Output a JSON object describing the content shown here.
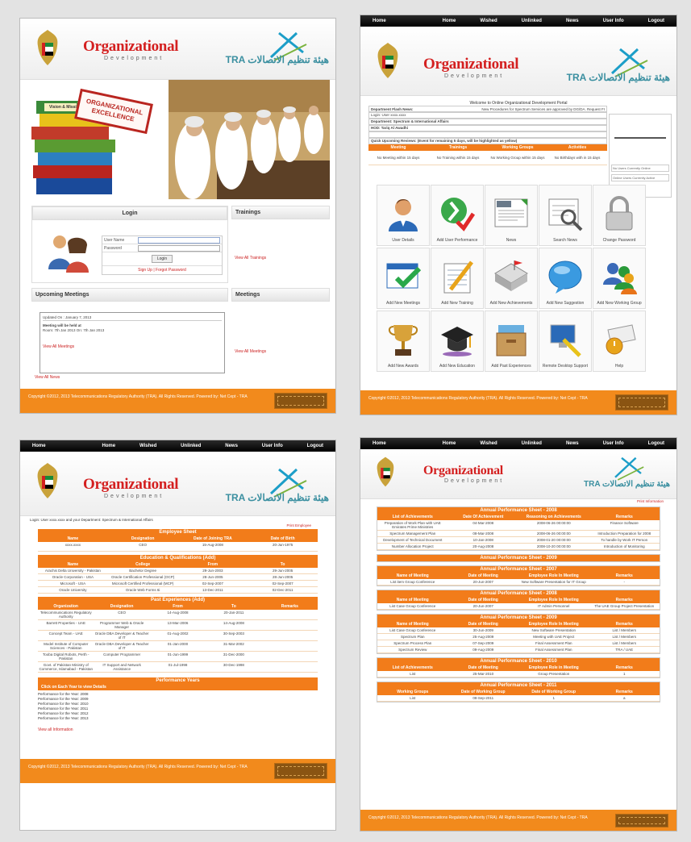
{
  "brand": {
    "title": "Organizational",
    "subtitle": "Development",
    "tdra": "TRA هيئة تنظيم الاتصالات"
  },
  "footer": {
    "text": "Copyright ©2012, 2013 Telecommunications Regulatory Authority (TRA). All Rights Reserved. Powered by: Net Cept - TRA"
  },
  "nav": [
    "Home",
    "Home",
    "Wished",
    "Unlinked",
    "News",
    "User Info",
    "Logout"
  ],
  "p1": {
    "banner": "ORGANIZATIONAL EXCELLENCE",
    "book_label": "Vision & Mission",
    "login": {
      "title": "Login",
      "user_label": "User Name",
      "pass_label": "Password",
      "button": "Login",
      "links": "Sign Up | Forgot Password"
    },
    "trainings": {
      "title": "Trainings",
      "link": "View All Trainings"
    },
    "upcoming": {
      "title": "Upcoming Meetings",
      "date": "Updated On : January 7, 2013",
      "heading": "Meeting will be held at",
      "line": "Room: 7th Jan 2013 On: 7th Jan 2013",
      "more": "View All Meetings",
      "news_link": "View All News"
    },
    "meetings": {
      "title": "Meetings",
      "link": "View All Meetings"
    }
  },
  "p2": {
    "welcome": "Welcome to Online Organizational Development Portal",
    "flash_label": "Department Flash News:",
    "flash_text": "New Procedures for Spectrum Services are approved by DG/DA. Request FI",
    "login_user": "Login: User  xxxx.xxxx",
    "department": "Department: Spectrum & International Affairs",
    "hod": "HOD: Tariq Al Awadhi",
    "reviews": "Quick Upcoming Reviews: (Event for remaining 5 days, will be highlighted as yellow)",
    "cols": [
      "Meeting",
      "Trainings",
      "Working Groups",
      "Activities"
    ],
    "vals": [
      "No Meeting within 15 days",
      "No Training within 15 days",
      "No Working Group within 15 days",
      "No Birthdays with in 15 days"
    ],
    "side": [
      "No Users Currently Online",
      "Online Users Currently Active"
    ],
    "icons": [
      {
        "name": "user-details",
        "label": "User Details"
      },
      {
        "name": "add-user-performance",
        "label": "Add User Performance"
      },
      {
        "name": "news",
        "label": "News"
      },
      {
        "name": "search-news",
        "label": "Search News"
      },
      {
        "name": "change-password",
        "label": "Change Password"
      },
      {
        "name": "add-new-meetings",
        "label": "Add New Meetings"
      },
      {
        "name": "add-new-training",
        "label": "Add New Training"
      },
      {
        "name": "add-new-achievements",
        "label": "Add New Achievements"
      },
      {
        "name": "add-new-suggestion",
        "label": "Add New Suggestion"
      },
      {
        "name": "add-new-working-group",
        "label": "Add New Working Group"
      },
      {
        "name": "add-new-awards",
        "label": "Add New Awards"
      },
      {
        "name": "add-new-education",
        "label": "Add New Education"
      },
      {
        "name": "add-past-experiences",
        "label": "Add Past Experiences"
      },
      {
        "name": "remote-desktop-support",
        "label": "Remote Desktop Support"
      },
      {
        "name": "help",
        "label": "Help"
      }
    ]
  },
  "p3": {
    "login_line": "Login: User  xxxx.xxxx  and your Department:  Spectrum & International Affairs",
    "print": "Print Employee",
    "employee_sheet": "Employee Sheet",
    "emp_cols": [
      "Name",
      "Designation",
      "Date of Joining TRA",
      "Date of Birth"
    ],
    "emp_vals": [
      "xxxx.xxxx",
      "CEO",
      "15-Aug-2008",
      "20-Jun-1975"
    ],
    "edu_title": "Education & Qualifications (Add)",
    "edu_cols": [
      "Name",
      "College",
      "From",
      "To"
    ],
    "edu_rows": [
      [
        "Arachis Delta University - Pakistan",
        "Bachelor Degree",
        "29-Jun-2003",
        "29-Jun-2005"
      ],
      [
        "Oracle Corporation - USA",
        "Oracle Certification Professional (OCP)",
        "28-Jun-2005",
        "28-Jun-2005"
      ],
      [
        "Microsoft - USA",
        "Microsoft Certified Professional (MCP)",
        "02-Sep-2007",
        "02-Sep-2007"
      ],
      [
        "Oracle University",
        "Oracle Web Forms 6i",
        "13-Dec-2011",
        "02-Dec-2011"
      ]
    ],
    "exp_title": "Past Experiences (Add)",
    "exp_cols": [
      "Organization",
      "Designation",
      "From",
      "To",
      "Remarks"
    ],
    "exp_rows": [
      [
        "Telecommunications Regulatory Authority",
        "CEO",
        "14-Aug-2008",
        "20-Jan-2011",
        ""
      ],
      [
        "Barrett Properties - UAE",
        "Programmer Web & Oracle Manager",
        "13-Mar-2006",
        "14-Aug-2008",
        ""
      ],
      [
        "Concept Team - UAE",
        "Oracle DBA Developer & Teacher of IT",
        "01-Aug-2002",
        "30-Sep-2003",
        ""
      ],
      [
        "Model Institute of Computer Sciences - Pakistan",
        "Oracle DBA Developer & Teacher of IT",
        "01-Jan-2000",
        "31-Mar-2002",
        ""
      ],
      [
        "Tooba Digital Robots, Perth - Pakistan",
        "Computer Programmer",
        "01-Jun-1999",
        "31-Dec-2000",
        ""
      ],
      [
        "Govt. of Pakistan Ministry of Commerce, Islamabad - Pakistan",
        "IT Support and Network Assistance",
        "01-Jul-1998",
        "30-Dec-1998",
        ""
      ]
    ],
    "perf_title": "Performance Years",
    "perf_sub": "Click on Each Year to view Details",
    "perf_years": [
      "Performance for the Year: 2008",
      "Performance for the Year: 2009",
      "Performance for the Year: 2010",
      "Performance for the Year: 2011",
      "Performance for the Year: 2012",
      "Performance for the Year: 2013"
    ],
    "view_all": "View all Information"
  },
  "p4": {
    "print": "Print Information",
    "sheets": [
      {
        "title": "Annual Performance Sheet - 2008",
        "cols": [
          "List of Achievements",
          "Date Of Achievement",
          "Reasoning on Achievements",
          "Remarks"
        ],
        "rows": [
          [
            "Preparation of Work Plan with UAE Emirates Prime Ministries",
            "04-Mar-2008",
            "2008-06-26 00:00:00",
            "Finance Software"
          ],
          [
            "Spectrum Management Plan",
            "08-Mar-2008",
            "2008-06-26 00:00:00",
            "Introduction Preparation for 2008"
          ],
          [
            "Development of Technical Document",
            "10-Jan-2008",
            "2008-01-20 00:00:00",
            "To handle by Work IT Person"
          ],
          [
            "Number Allocation Project",
            "20-Aug-2008",
            "2008-10-20 00:00:00",
            "Introduction of Monitoring"
          ]
        ]
      },
      {
        "title": "Annual Performance Sheet - 2009",
        "cols": [],
        "rows": []
      },
      {
        "title": "Annual Performance Sheet - 2007",
        "cols": [
          "Name of Meeting",
          "Date of Meeting",
          "Employee Role In Meeting",
          "Remarks"
        ],
        "rows": [
          [
            "List item Group Conference",
            "20-Jun-2007",
            "New Software Presentation for IT Group",
            "-"
          ]
        ]
      },
      {
        "title": "Annual Performance Sheet - 2008",
        "cols": [
          "Name of Meeting",
          "Date of Meeting",
          "Employee Role In Meeting",
          "Remarks"
        ],
        "rows": [
          [
            "List Case Group Conference",
            "20-Jun-2007",
            "IT Admin Personnel",
            "The UAE Group Project Presentation"
          ]
        ]
      },
      {
        "title": "Annual Performance Sheet - 2009",
        "cols": [
          "Name of Meeting",
          "Date of Meeting",
          "Employee Role In Meeting",
          "Remarks"
        ],
        "rows": [
          [
            "List Case Group Conference",
            "30-Jun-2009",
            "New Software Presentation",
            "List / Members"
          ],
          [
            "Spectrum Plan",
            "25-Aug-2009",
            "Meeting with UAE Project",
            "List / Members"
          ],
          [
            "Spectrum Process Plan",
            "07-Sep-2009",
            "Final Assessment Plan",
            "List / Members"
          ],
          [
            "Spectrum Review",
            "09-Aug-2009",
            "Final Assessment Plan",
            "TRA / UAE"
          ]
        ]
      },
      {
        "title": "Annual Performance Sheet - 2010",
        "cols": [
          "List of Achievements",
          "Date of Meeting",
          "Employee Role in Meeting",
          "Remarks"
        ],
        "rows": [
          [
            "List",
            "25-Mar-2010",
            "Group Presentation",
            "1"
          ]
        ]
      },
      {
        "title": "Annual Performance Sheet - 2011",
        "cols": [
          "Working Groups",
          "Date of Working Group",
          "Date of Working Group",
          "Remarks"
        ],
        "rows": [
          [
            "List",
            "08-Sep-2011",
            "1",
            "a"
          ]
        ]
      }
    ]
  }
}
